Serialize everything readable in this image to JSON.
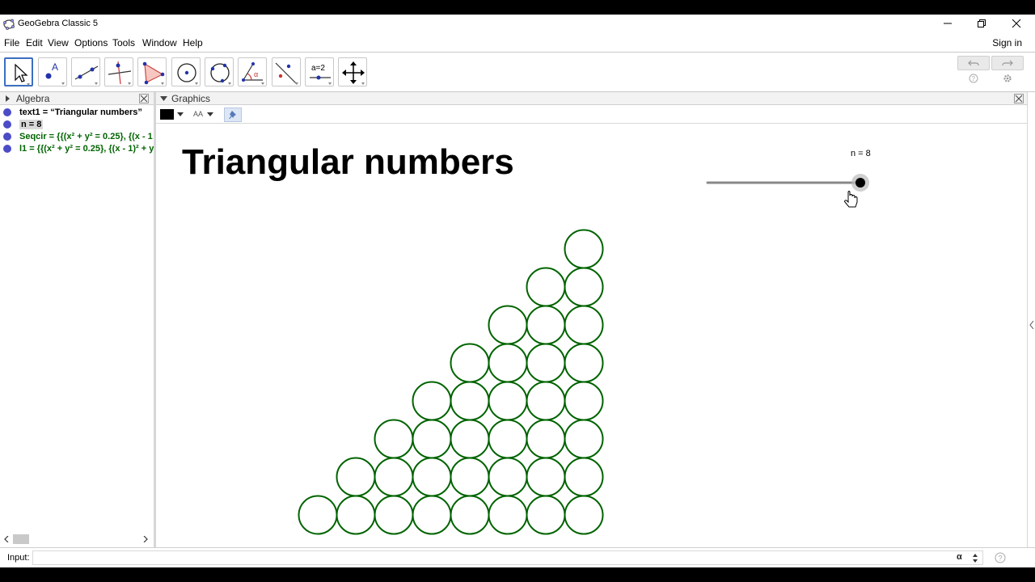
{
  "window": {
    "title": "GeoGebra Classic 5",
    "controls": [
      "minimize-icon",
      "restore-icon",
      "close-icon"
    ]
  },
  "menu": {
    "items": [
      "File",
      "Edit",
      "View",
      "Options",
      "Tools",
      "Window",
      "Help"
    ],
    "signin": "Sign in"
  },
  "toolbar": {
    "tools": [
      "move-tool",
      "point-tool",
      "line-tool",
      "perpendicular-line-tool",
      "polygon-tool",
      "circle-center-point-tool",
      "circle-three-points-tool",
      "angle-tool",
      "reflect-tool",
      "slider-tool",
      "move-graphics-view-tool"
    ],
    "slider_tool_text": "a=2",
    "angle_tool_text": "α",
    "active_tool": "move-tool"
  },
  "algebra": {
    "header": "Algebra",
    "rows": [
      {
        "text": "text1 = “Triangular numbers”",
        "color": "#000000"
      },
      {
        "text": "n = 8",
        "color": "#000000"
      },
      {
        "text": "Seqcir = {{(x² + y² = 0.25}, {(x - 1",
        "color": "#006400"
      },
      {
        "text": "l1 = {{(x² + y² = 0.25}, {(x - 1)² + y",
        "color": "#006400"
      }
    ]
  },
  "graphics": {
    "header": "Graphics",
    "title_text": "Triangular numbers",
    "slider": {
      "name": "n",
      "label": "n = 8",
      "value": 8,
      "min": 1,
      "max": 8
    },
    "circle_color": "#006400",
    "style_bar": {
      "color_swatch": "#000000",
      "text_size_label": "AA"
    }
  },
  "input": {
    "label": "Input:",
    "value": "",
    "alpha_symbol": "α"
  }
}
